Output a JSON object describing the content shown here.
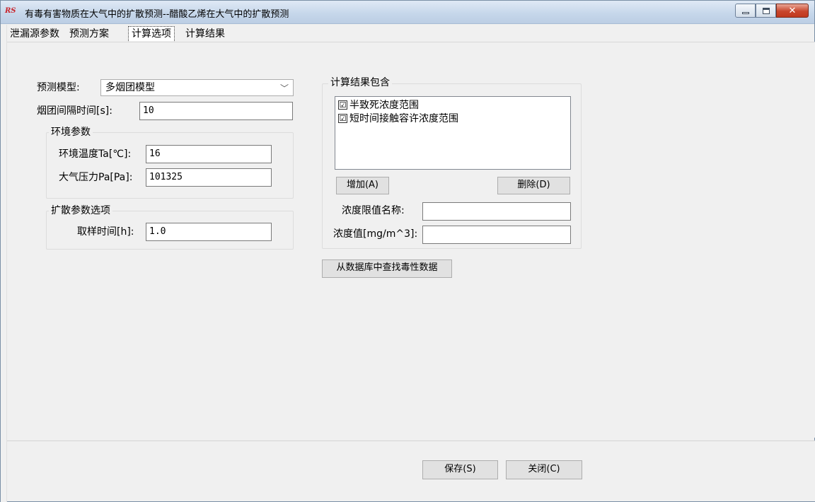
{
  "window": {
    "title": "有毒有害物质在大气中的扩散预测--醋酸乙烯在大气中的扩散预测",
    "app_logo_text": "RS",
    "close_glyph": "✕"
  },
  "tabs": [
    {
      "label": "泄漏源参数"
    },
    {
      "label": "预测方案"
    },
    {
      "label": "计算选项"
    },
    {
      "label": "计算结果"
    }
  ],
  "form": {
    "model_label": "预测模型:",
    "model_value": "多烟团模型",
    "puff_interval_label": "烟团间隔时间[s]:",
    "puff_interval_value": "10",
    "env_group_title": "环境参数",
    "temp_label": "环境温度Ta[℃]:",
    "temp_value": "16",
    "pressure_label": "大气压力Pa[Pa]:",
    "pressure_value": "101325",
    "diffusion_group_title": "扩散参数选项",
    "sampling_label": "取样时间[h]:",
    "sampling_value": "1.0"
  },
  "results_group": {
    "title": "计算结果包含",
    "items": [
      {
        "label": "半致死浓度范围",
        "checked": "☑"
      },
      {
        "label": "短时间接触容许浓度范围",
        "checked": "☑"
      }
    ],
    "add_button": "增加(A)",
    "delete_button": "删除(D)",
    "limit_name_label": "浓度限值名称:",
    "limit_name_value": "",
    "conc_label": "浓度值[mg/m^3]:",
    "conc_value": ""
  },
  "lookup_button": "从数据库中查找毒性数据",
  "footer": {
    "save_button": "保存(S)",
    "close_button": "关闭(C)"
  }
}
